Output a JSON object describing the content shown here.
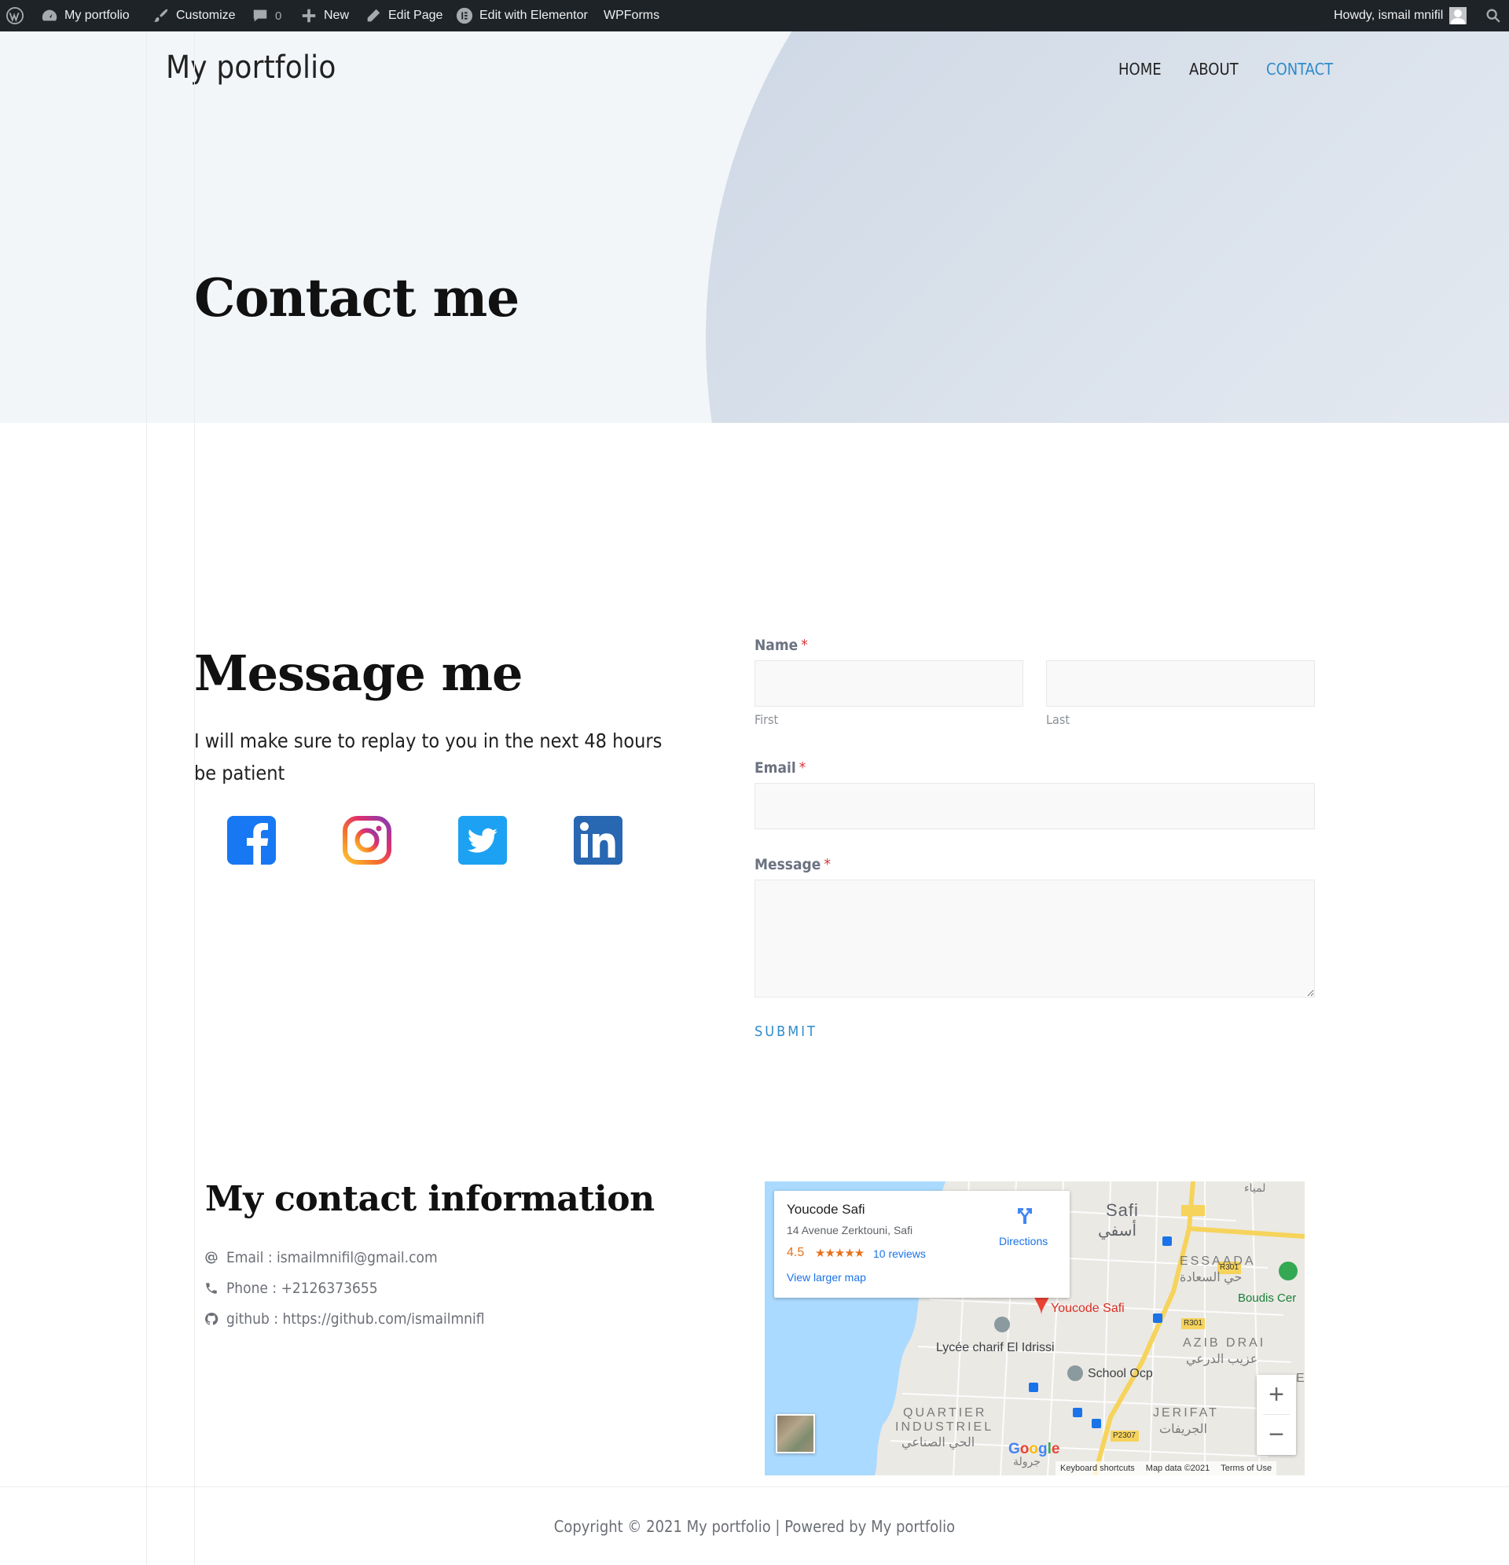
{
  "admin_bar": {
    "site_name": "My portfolio",
    "customize": "Customize",
    "comments_count": "0",
    "new": "New",
    "edit_page": "Edit Page",
    "edit_elementor": "Edit with Elementor",
    "wpforms": "WPForms",
    "howdy": "Howdy, ismail mnifil"
  },
  "header": {
    "site_title": "My portfolio",
    "nav": [
      {
        "label": "HOME"
      },
      {
        "label": "ABOUT"
      },
      {
        "label": "CONTACT",
        "active": true
      }
    ]
  },
  "hero": {
    "title": "Contact me"
  },
  "message": {
    "title": "Message me",
    "text": "I will make sure to replay to you in the next 48 hours be patient",
    "social": [
      {
        "icon": "facebook-icon"
      },
      {
        "icon": "instagram-icon"
      },
      {
        "icon": "twitter-icon"
      },
      {
        "icon": "linkedin-icon"
      }
    ]
  },
  "form": {
    "name_label": "Name",
    "required_mark": "*",
    "first_label": "First",
    "last_label": "Last",
    "first_value": "",
    "last_value": "",
    "email_label": "Email",
    "email_value": "",
    "message_label": "Message",
    "message_value": "",
    "submit_label": "SUBMIT"
  },
  "contact_info": {
    "title": "My contact information",
    "email": "Email : ismailmnifil@gmail.com",
    "phone": "Phone : +2126373655",
    "github": "github : https://github.com/ismailmnifl"
  },
  "map": {
    "place_name": "Youcode Safi",
    "address": "14 Avenue Zerktouni, Safi",
    "rating": "4.5",
    "stars": "★★★★★",
    "reviews": "10 reviews",
    "view_larger": "View larger map",
    "directions": "Directions",
    "labels": {
      "safi": "Safi",
      "safi_ar": "أسفي",
      "essaada": "ESSAADA",
      "essaada_ar": "حي السعادة",
      "boudis": "Boudis Cer",
      "youcode_pin": "Youcode Safi",
      "lycee": "Lycée charif El Idrissi",
      "azib": "AZIB DRAI",
      "azib_ar": "عزيب الدرعي",
      "school": "School Ocp",
      "quartier": "QUARTIER",
      "industriel": "INDUSTRIEL",
      "industriel_ar": "الحي الصناعي",
      "jerifat": "JERIFAT",
      "jerifat_ar": "الجريفات",
      "r301": "R301",
      "p2307": "P2307",
      "lamia_ar": "لمياء",
      "jarouala_ar": "جرولة",
      "edge_e": "E"
    },
    "google": "Google",
    "keyboard": "Keyboard shortcuts",
    "map_data": "Map data ©2021",
    "terms": "Terms of Use",
    "zoom_in": "+",
    "zoom_out": "−",
    "colors": {
      "sea": "#aadaff",
      "road": "#f6d35b",
      "land": "#e8e8e8",
      "link": "#1a73e8",
      "pin": "#ea4335"
    }
  },
  "footer": {
    "copyright": "Copyright © 2021 My portfolio | Powered by My portfolio"
  },
  "colors": {
    "admin_bg": "#1d2327",
    "accent": "#2f8bc9",
    "hero_bg": "#f3f6f9",
    "required": "#d63638"
  }
}
